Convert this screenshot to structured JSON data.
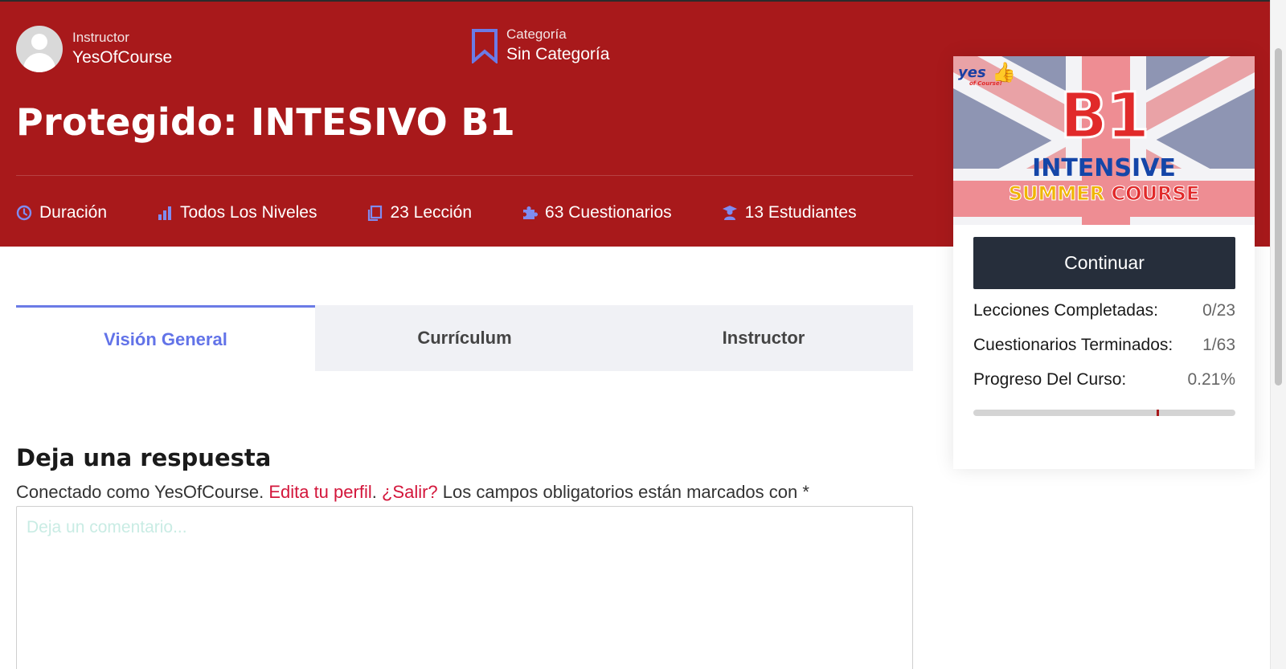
{
  "header": {
    "instructor_label": "Instructor",
    "instructor_name": "YesOfCourse",
    "category_label": "Categoría",
    "category_value": "Sin Categoría",
    "title": "Protegido: INTESIVO B1",
    "stats": [
      {
        "icon": "clock-icon",
        "label": "Duración"
      },
      {
        "icon": "bar-chart-icon",
        "label": "Todos Los Niveles"
      },
      {
        "icon": "copy-icon",
        "label": "23 Lección"
      },
      {
        "icon": "puzzle-icon",
        "label": "63 Cuestionarios"
      },
      {
        "icon": "graduate-icon",
        "label": "13 Estudiantes"
      }
    ]
  },
  "tabs": [
    {
      "label": "Visión General",
      "active": true
    },
    {
      "label": "Currículum",
      "active": false
    },
    {
      "label": "Instructor",
      "active": false
    }
  ],
  "reply": {
    "title": "Deja una respuesta",
    "logged_prefix": "Conectado como YesOfCourse.",
    "edit_profile": "Edita tu perfil",
    "logout": "¿Salir?",
    "required_note": "Los campos obligatorios están marcados con *",
    "comment_placeholder": "Deja un comentario..."
  },
  "card": {
    "banner": {
      "logo": "yes",
      "logo_sub": "of Course!",
      "level": "B1",
      "line1": "INTENSIVE",
      "line2_a": "SUMMER",
      "line2_b": "COURSE"
    },
    "continue_label": "Continuar",
    "lessons_label": "Lecciones Completadas:",
    "lessons_value": "0/23",
    "quizzes_label": "Cuestionarios Terminados:",
    "quizzes_value": "1/63",
    "progress_label": "Progreso Del Curso:",
    "progress_value": "0.21%",
    "progress_marker_fraction": 0.7
  },
  "colors": {
    "header_bg": "#a8191b",
    "accent": "#6b7be6",
    "link": "#d3163b",
    "button": "#262e3b"
  }
}
